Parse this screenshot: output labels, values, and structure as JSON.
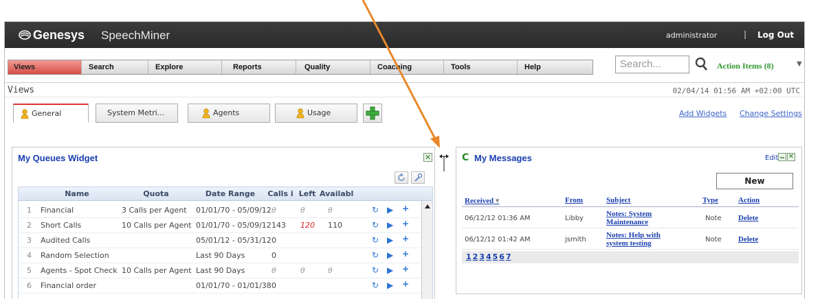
{
  "header": {
    "logo": "Genesys",
    "product": "SpeechMiner",
    "user": "administrator",
    "separator": "|",
    "logout": "Log Out"
  },
  "nav": {
    "items": [
      "Views",
      "Search",
      "Explore",
      "Reports",
      "Quality",
      "Coaching",
      "Tools",
      "Help"
    ],
    "active": "Views"
  },
  "search": {
    "placeholder": "Search..."
  },
  "action_items": "Action Items (8)",
  "subheader": {
    "title": "Views",
    "datetime": "02/04/14 01:56 AM +02:00 UTC"
  },
  "tabs": [
    {
      "label": "General",
      "active": true
    },
    {
      "label": "System Metri..."
    },
    {
      "label": "Agents"
    },
    {
      "label": "Usage"
    }
  ],
  "links": {
    "add_widgets": "Add Widgets",
    "change_settings": "Change Settings"
  },
  "queues_widget": {
    "title": "My Queues Widget",
    "columns": [
      "Name",
      "Quota",
      "Date Range",
      "Calls i",
      "Left",
      "Available"
    ],
    "rows": [
      {
        "idx": "1",
        "name": "Financial",
        "quota": "3 Calls per Agent",
        "range": "01/01/70 - 05/09/12",
        "calls": "θ",
        "left": "θ",
        "avail": "θ"
      },
      {
        "idx": "2",
        "name": "Short Calls",
        "quota": "10 Calls per Agent",
        "range": "01/01/70 - 05/09/12",
        "calls": "143",
        "left": "120",
        "avail": "110"
      },
      {
        "idx": "3",
        "name": "Audited Calls",
        "quota": "",
        "range": "05/01/12 - 05/31/12",
        "calls": "0",
        "left": "",
        "avail": ""
      },
      {
        "idx": "4",
        "name": "Random Selection",
        "quota": "",
        "range": "Last 90 Days",
        "calls": "0",
        "left": "",
        "avail": ""
      },
      {
        "idx": "5",
        "name": "Agents - Spot Check",
        "quota": "10 Calls per Agent",
        "range": "Last 90 Days",
        "calls": "θ",
        "left": "θ",
        "avail": "θ"
      },
      {
        "idx": "6",
        "name": "Financial order",
        "quota": "",
        "range": "01/01/70 - 01/01/38",
        "calls": "0",
        "left": "",
        "avail": ""
      }
    ]
  },
  "messages_widget": {
    "title": "My Messages",
    "edit": "Edit",
    "new_button": "New",
    "columns": [
      "Received",
      "From",
      "Subject",
      "Type",
      "Action"
    ],
    "sort_indicator": "▾",
    "rows": [
      {
        "received": "06/12/12 01:36 AM",
        "from": "Libby",
        "subject": "Notes: System Maintenance",
        "type": "Note",
        "action": "Delete"
      },
      {
        "received": "06/12/12 01:42 AM",
        "from": "jsmith",
        "subject": "Notes: Help with system testing",
        "type": "Note",
        "action": "Delete"
      }
    ],
    "pages": [
      "1",
      "2",
      "3",
      "4",
      "5",
      "6",
      "7"
    ]
  },
  "colors": {
    "annotation_arrow": "#e8882a",
    "nav_active": "#d74d47",
    "link": "#1a3fb0",
    "action_items": "#2f9a2f"
  },
  "icons": [
    "genesys-logo-icon",
    "search-icon",
    "person-icon",
    "add-tab-icon",
    "refresh-icon",
    "wrench-icon",
    "close-icon",
    "minimize-icon",
    "resize-arrow-icon",
    "row-refresh-icon",
    "play-icon",
    "plus-icon"
  ]
}
